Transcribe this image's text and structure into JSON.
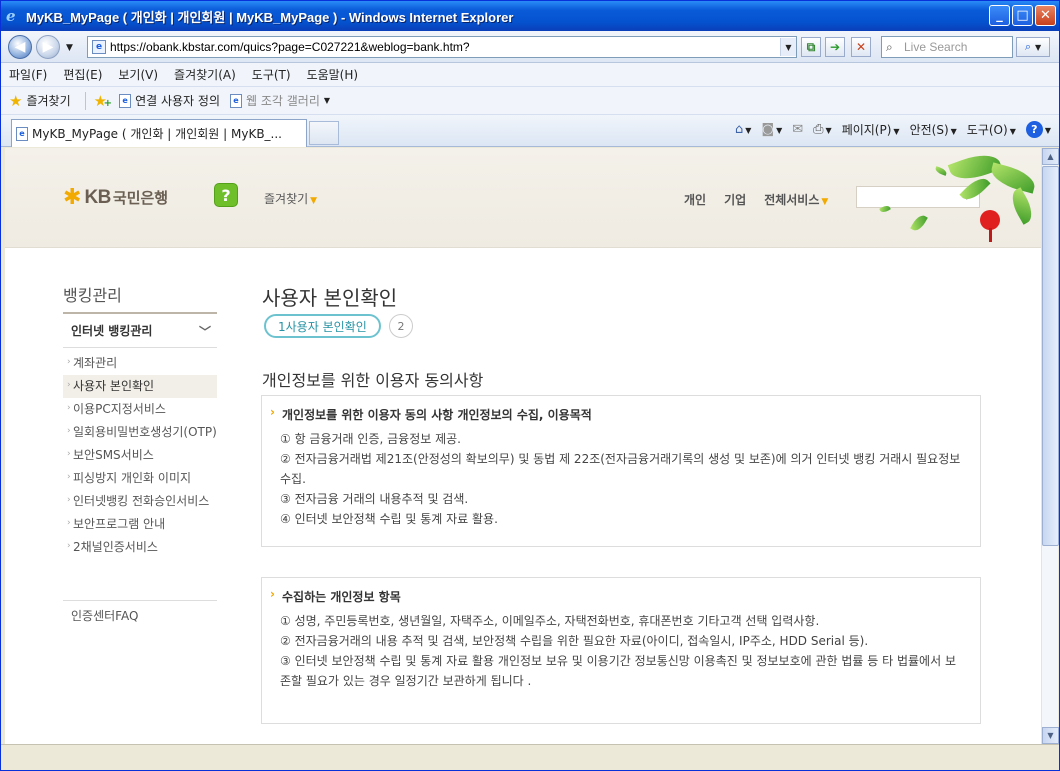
{
  "window": {
    "title": "MyKB_MyPage ( 개인화 | 개인회원 | MyKB_MyPage ) - Windows Internet Explorer"
  },
  "address": {
    "url": "https://obank.kbstar.com/quics?page=C027221&weblog=bank.htm?"
  },
  "search": {
    "placeholder": "Live Search"
  },
  "menu": [
    "파일(F)",
    "편집(E)",
    "보기(V)",
    "즐겨찾기(A)",
    "도구(T)",
    "도움말(H)"
  ],
  "favorites_bar": {
    "favorites": "즐겨찾기",
    "link1": "연결 사용자 정의",
    "link2": "웹 조각 갤러리"
  },
  "tab": {
    "label": "MyKB_MyPage ( 개인화 | 개인회원 | MyKB_..."
  },
  "commands": {
    "page": "페이지(P)",
    "safety": "안전(S)",
    "tools": "도구(O)"
  },
  "site": {
    "logo_kb": "KB",
    "logo_bank": "국민은행",
    "help": "?",
    "favorites": "즐겨찾기",
    "nav": [
      "개인",
      "기업",
      "전체서비스"
    ]
  },
  "left_nav": {
    "title": "뱅킹관리",
    "group": "인터넷 뱅킹관리",
    "items": [
      "계좌관리",
      "사용자 본인확인",
      "이용PC지정서비스",
      "일회용비밀번호생성기(OTP)",
      "보안SMS서비스",
      "피싱방지 개인화 이미지",
      "인터넷뱅킹 전화승인서비스",
      "보안프로그램 안내",
      "2채널인증서비스"
    ],
    "faq": "인증센터FAQ"
  },
  "main": {
    "title": "사용자 본인확인",
    "step1": "1사용자 본인확인",
    "step2": "2",
    "section_title": "개인정보를 위한 이용자 동의사항",
    "box1": {
      "heading": "개인정보를 위한 이용자 동의 사항 개인정보의 수집, 이용목적",
      "lines": [
        "① 항 금융거래 인증, 금융정보 제공.",
        "② 전자금융거래법 제21조(안정성의 확보의무) 및 동법 제 22조(전자금융거래기록의 생성 및 보존)에 의거 인터넷 뱅킹 거래시 필요정보 수집.",
        "③ 전자금융 거래의 내용추적 및 검색.",
        "④ 인터넷 보안정책 수립 및 통계 자료 활용."
      ]
    },
    "box2": {
      "heading": "수집하는 개인정보 항목",
      "lines": [
        "① 성명, 주민등록번호, 생년월일, 자택주소, 이메일주소, 자택전화번호, 휴대폰번호 기타고객 선택 입력사항.",
        "② 전자금융거래의 내용 추적 및 검색, 보안정책 수립을 위한 필요한 자료(아이디, 접속일시, IP주소, HDD Serial 등).",
        "③ 인터넷 보안정책 수립 및 통계 자료 활용 개인정보 보유 및 이용기간 정보통신망 이용촉진 및 정보보호에 관한 법률 등 타 법률에서 보존할 필요가 있는 경우 일정기간 보관하게 됩니다 ."
      ]
    }
  }
}
